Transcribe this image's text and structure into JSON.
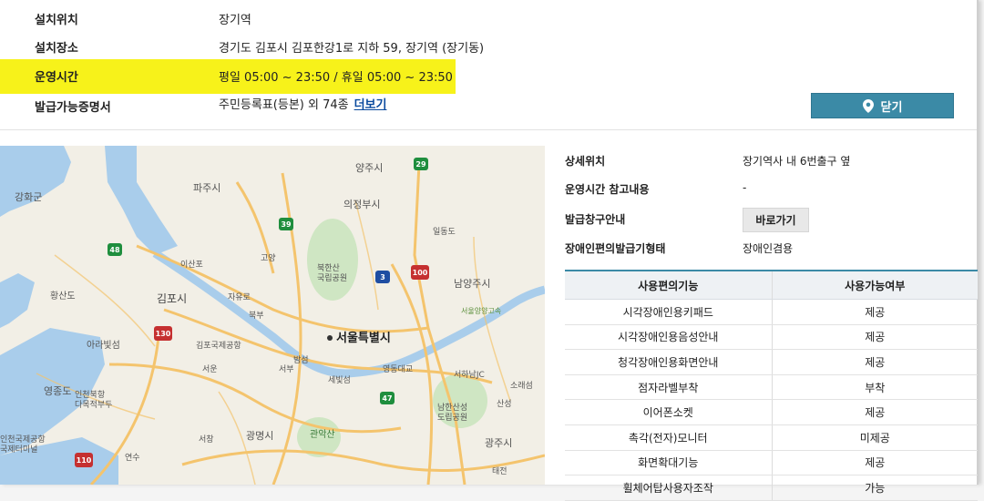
{
  "info": {
    "location_label": "설치위치",
    "location_value": "장기역",
    "place_label": "설치장소",
    "place_value": "경기도 김포시 김포한강1로 지하 59, 장기역 (장기동)",
    "hours_label": "운영시간",
    "hours_value": "평일 05:00 ~ 23:50 / 휴일 05:00 ~ 23:50",
    "certs_label": "발급가능증명서",
    "certs_value": "주민등록표(등본) 외 74종",
    "more_link": "더보기"
  },
  "close_button": "닫기",
  "details": {
    "detail_loc_label": "상세위치",
    "detail_loc_value": "장기역사 내 6번출구 옆",
    "hours_note_label": "운영시간 참고내용",
    "hours_note_value": "-",
    "window_label": "발급창구안내",
    "window_button": "바로가기",
    "access_label": "장애인편의발급기형태",
    "access_value": "장애인겸용"
  },
  "features": {
    "headers": [
      "사용편의기능",
      "사용가능여부"
    ],
    "rows": [
      [
        "시각장애인용키패드",
        "제공"
      ],
      [
        "시각장애인용음성안내",
        "제공"
      ],
      [
        "청각장애인용화면안내",
        "제공"
      ],
      [
        "점자라벨부착",
        "부착"
      ],
      [
        "이어폰소켓",
        "제공"
      ],
      [
        "촉각(전자)모니터",
        "미제공"
      ],
      [
        "화면확대기능",
        "제공"
      ],
      [
        "휠체어탑사용자조작",
        "가능"
      ]
    ]
  },
  "map": {
    "labels": {
      "yangju": "양주시",
      "paju": "파주시",
      "ganghwa": "강화군",
      "uijeongbu": "의정부시",
      "bukhansan": "북한산\n국립공원",
      "namyangju": "남양주시",
      "gimpo": "김포시",
      "seoul": "서울특별시",
      "gimpo_airport": "김포국제공항",
      "incheon_airport": "인천북항\n다목적부두",
      "gwangmyeong": "광명시",
      "gwanaksan": "관악산",
      "gwangju": "광주시",
      "yeongjong": "영종도",
      "arabit": "아라빛섬",
      "hwangsando": "황산도",
      "namhansan": "남한산성\n도립공원",
      "isan": "이산포",
      "goyang": "고양",
      "jayuro": "자유로",
      "bukbu": "북부",
      "seoun": "서운",
      "seochang": "서창",
      "yeonsu": "연수",
      "seobu": "서부",
      "seunghwa": "세빛섬",
      "bamseom": "밤섬",
      "yeongdongdaegyo": "영동대교",
      "seohanam": "서하남JC",
      "sanseong": "산성",
      "soyang": "소래섬",
      "taejeon": "태전",
      "ildongdo": "일동도",
      "incheon_airport2": "인천국제공항\n국제터미널",
      "seoul_yangyang": "서울양양고속"
    },
    "shields": [
      "29",
      "39",
      "48",
      "3",
      "100",
      "130",
      "47",
      "110"
    ]
  }
}
